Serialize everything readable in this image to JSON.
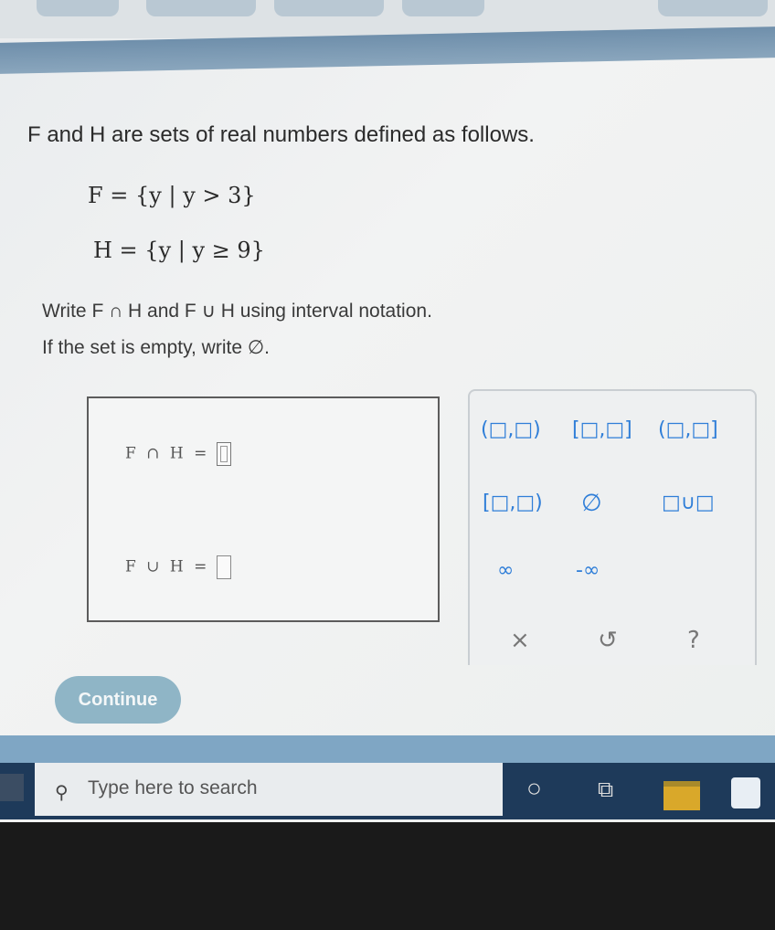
{
  "problem": {
    "intro": "F and H are sets of real numbers defined as follows.",
    "set_f": "F = {y | y > 3}",
    "set_h": "H = {y | y ≥ 9}",
    "instruction_1": "Write F ∩ H and F ∪ H using interval notation.",
    "instruction_2": "If the set is empty, write ∅."
  },
  "answer_box": {
    "intersection_label": "F ∩ H =",
    "union_label": "F ∪ H ="
  },
  "keypad": {
    "keys": {
      "open_open": "(□,□)",
      "closed_closed": "[□,□]",
      "open_closed": "(□,□]",
      "closed_open": "[□,□)",
      "empty_set": "∅",
      "union": "□∪□",
      "infinity": "∞",
      "neg_infinity": "-∞",
      "clear": "×",
      "undo": "↺",
      "help": "?"
    }
  },
  "continue_button": "Continue",
  "taskbar": {
    "search_placeholder": "Type here to search"
  },
  "colors": {
    "keypad_accent": "#2f7ed8",
    "continue_bg": "#8fb5c6",
    "taskbar": "#1e3a5a"
  }
}
